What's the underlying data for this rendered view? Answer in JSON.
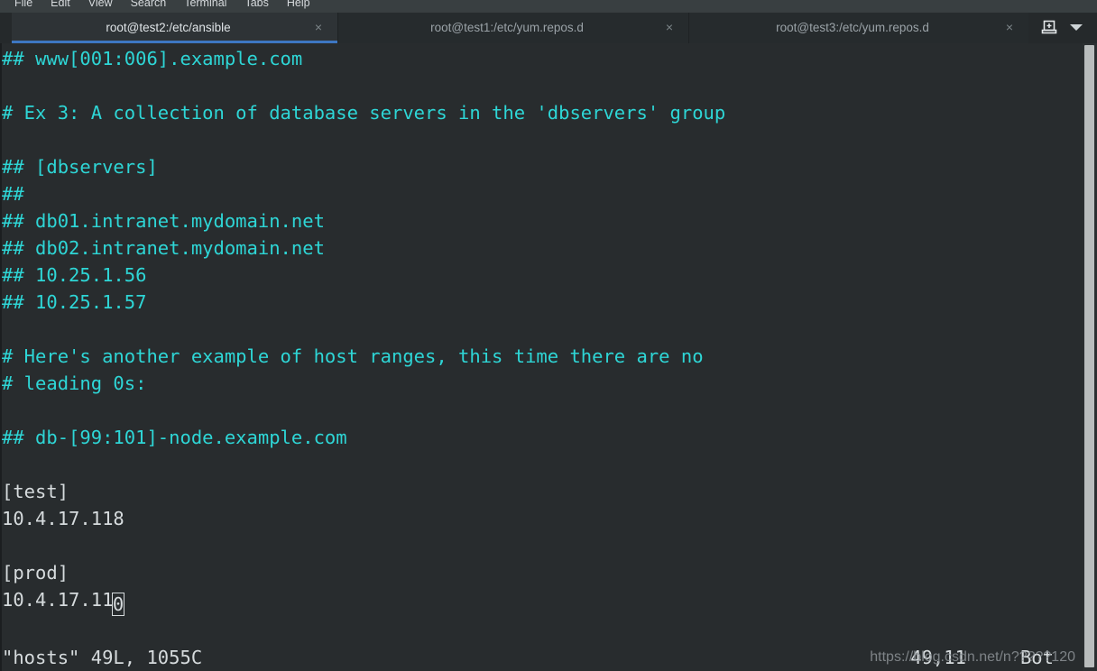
{
  "window": {
    "menu": [
      "File",
      "Edit",
      "View",
      "Search",
      "Terminal",
      "Tabs",
      "Help"
    ]
  },
  "tabs": [
    {
      "title": "root@test2:/etc/ansible",
      "active": true,
      "close_glyph": "×"
    },
    {
      "title": "root@test1:/etc/yum.repos.d",
      "active": false,
      "close_glyph": "×"
    },
    {
      "title": "root@test3:/etc/yum.repos.d",
      "active": false,
      "close_glyph": "×"
    }
  ],
  "tab_actions": {
    "new_tab_label": "new-tab",
    "menu_label": "tab-list"
  },
  "terminal": {
    "lines": [
      {
        "text": "## www[001:006].example.com",
        "type": "comment"
      },
      {
        "text": "",
        "type": "blank"
      },
      {
        "text": "# Ex 3: A collection of database servers in the 'dbservers' group",
        "type": "comment"
      },
      {
        "text": "",
        "type": "blank"
      },
      {
        "text": "## [dbservers]",
        "type": "comment"
      },
      {
        "text": "##",
        "type": "comment"
      },
      {
        "text": "## db01.intranet.mydomain.net",
        "type": "comment"
      },
      {
        "text": "## db02.intranet.mydomain.net",
        "type": "comment"
      },
      {
        "text": "## 10.25.1.56",
        "type": "comment"
      },
      {
        "text": "## 10.25.1.57",
        "type": "comment"
      },
      {
        "text": "",
        "type": "blank"
      },
      {
        "text": "# Here's another example of host ranges, this time there are no",
        "type": "comment"
      },
      {
        "text": "# leading 0s:",
        "type": "comment"
      },
      {
        "text": "",
        "type": "blank"
      },
      {
        "text": "## db-[99:101]-node.example.com",
        "type": "comment"
      },
      {
        "text": "",
        "type": "blank"
      },
      {
        "text": "[test]",
        "type": "plain"
      },
      {
        "text": "10.4.17.118",
        "type": "plain"
      },
      {
        "text": "",
        "type": "blank"
      },
      {
        "text": "[prod]",
        "type": "plain"
      },
      {
        "text": "10.4.17.11",
        "type": "plain",
        "cursor_char": "0"
      }
    ],
    "status": {
      "file_info": "\"hosts\" 49L, 1055C",
      "position": "49,11",
      "scroll": "Bot"
    }
  },
  "watermark": {
    "text": "https://blog.csdn.net/n?????120"
  },
  "colors": {
    "terminal_background": "#282c2e",
    "comment": "#2ed6d6",
    "foreground": "#d6dbdd",
    "tab_active_underline": "#3d77c2",
    "scrollbar_thumb": "#b9bdbd"
  }
}
